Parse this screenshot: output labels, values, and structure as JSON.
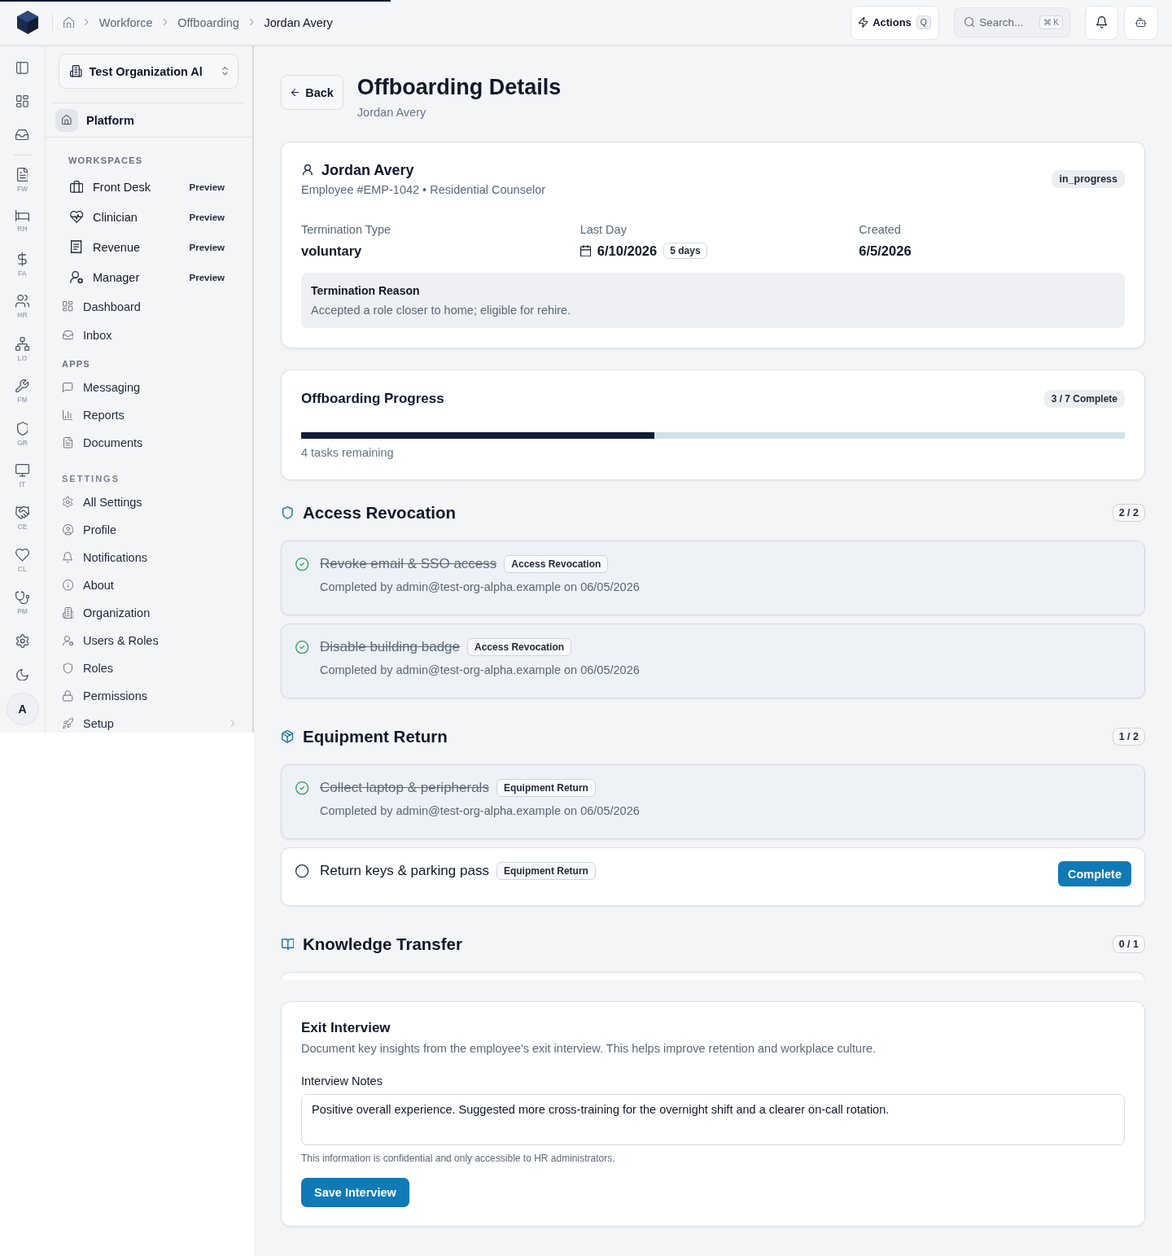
{
  "loading_bar": {
    "level": 0.333
  },
  "topbar": {
    "breadcrumbs": [
      {
        "label": "Workforce",
        "current": false
      },
      {
        "label": "Offboarding",
        "current": false
      },
      {
        "label": "Jordan Avery",
        "current": true
      }
    ],
    "actions": {
      "label": "Actions",
      "shortcut": "Q"
    },
    "search": {
      "placeholder": "Search...",
      "shortcut": "⌘ K"
    }
  },
  "rail": {
    "items": [
      {
        "label": "FW"
      },
      {
        "label": "RH"
      },
      {
        "label": "FA"
      },
      {
        "label": "HR"
      },
      {
        "label": "LO"
      },
      {
        "label": "FM"
      },
      {
        "label": "GR"
      },
      {
        "label": "IT"
      },
      {
        "label": "CE"
      },
      {
        "label": "CL"
      },
      {
        "label": "PM"
      }
    ],
    "avatar": "A"
  },
  "sidebar": {
    "organization": "Test Organization Al",
    "platform": "Platform",
    "groups": [
      {
        "title": "WORKSPACES",
        "items": [
          {
            "kind": "workspace",
            "label": "Front Desk",
            "badge": "Preview"
          },
          {
            "kind": "workspace",
            "label": "Clinician",
            "badge": "Preview"
          },
          {
            "kind": "workspace",
            "label": "Revenue",
            "badge": "Preview"
          },
          {
            "kind": "workspace",
            "label": "Manager",
            "badge": "Preview"
          },
          {
            "kind": "link",
            "label": "Dashboard"
          },
          {
            "kind": "link",
            "label": "Inbox"
          }
        ]
      },
      {
        "title": "APPS",
        "items": [
          {
            "kind": "link",
            "label": "Messaging"
          },
          {
            "kind": "link",
            "label": "Reports"
          },
          {
            "kind": "link",
            "label": "Documents"
          }
        ]
      },
      {
        "title": "SETTINGS",
        "items": [
          {
            "kind": "link",
            "label": "All Settings"
          },
          {
            "kind": "link",
            "label": "Profile"
          },
          {
            "kind": "link",
            "label": "Notifications"
          },
          {
            "kind": "link",
            "label": "About"
          },
          {
            "kind": "link",
            "label": "Organization"
          },
          {
            "kind": "link",
            "label": "Users & Roles"
          },
          {
            "kind": "link",
            "label": "Roles"
          },
          {
            "kind": "link",
            "label": "Permissions"
          },
          {
            "kind": "group",
            "label": "Setup",
            "expanded": false
          }
        ]
      }
    ]
  },
  "header": {
    "back": "Back",
    "title": "Offboarding Details",
    "subtitle": "Jordan Avery"
  },
  "employee": {
    "name": "Jordan Avery",
    "details": "Employee #EMP-1042 • Residential Counselor",
    "status": "in_progress",
    "fields": [
      {
        "kind": "text",
        "label": "Termination Type",
        "value": "voluntary"
      },
      {
        "kind": "date",
        "label": "Last Day",
        "value": "6/10/2026",
        "badge": "5 days"
      },
      {
        "kind": "text",
        "label": "Created",
        "value": "6/5/2026"
      }
    ],
    "reason": {
      "title": "Termination Reason",
      "text": "Accepted a role closer to home; eligible for rehire."
    }
  },
  "progress": {
    "title": "Offboarding Progress",
    "badge": "3 / 7 Complete",
    "level": 0.4286,
    "caption": "4 tasks remaining"
  },
  "sections": [
    {
      "title": "Access Revocation",
      "count": "2 / 2",
      "tasks": [
        {
          "title": "Revoke email & SSO access",
          "tag": "Access Revocation",
          "completed": true,
          "note": "Completed by admin@test-org-alpha.example on 06/05/2026"
        },
        {
          "title": "Disable building badge",
          "tag": "Access Revocation",
          "completed": true,
          "note": "Completed by admin@test-org-alpha.example on 06/05/2026"
        }
      ]
    },
    {
      "title": "Equipment Return",
      "count": "1 / 2",
      "tasks": [
        {
          "title": "Collect laptop & peripherals",
          "tag": "Equipment Return",
          "completed": true,
          "note": "Completed by admin@test-org-alpha.example on 06/05/2026"
        },
        {
          "title": "Return keys & parking pass",
          "tag": "Equipment Return",
          "completed": false,
          "action": "Complete"
        }
      ]
    },
    {
      "title": "Knowledge Transfer",
      "count": "0 / 1",
      "cut_off_card": true
    }
  ],
  "exit_interview": {
    "title": "Exit Interview",
    "description": "Document key insights from the employee's exit interview. This helps improve retention and workplace culture.",
    "field_label": "Interview Notes",
    "value": "Positive overall experience. Suggested more cross-training for the overnight shift and a clearer on-call rotation.",
    "help": "This information is confidential and only accessible to HR administrators.",
    "button": "Save Interview"
  }
}
